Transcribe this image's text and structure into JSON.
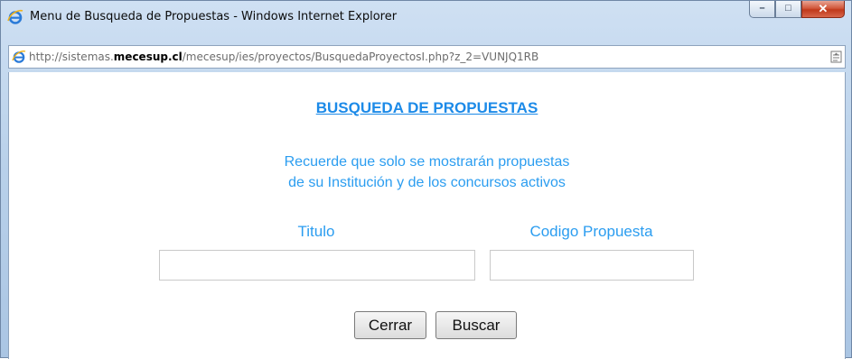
{
  "window": {
    "title": "Menu de Busqueda de Propuestas - Windows Internet Explorer",
    "controls": {
      "minimize": "–",
      "maximize": "□",
      "close": "✕"
    }
  },
  "address_bar": {
    "url_prefix": "http://sistemas.",
    "url_domain": "mecesup.cl",
    "url_path": "/mecesup/ies/proyectos/BusquedaProyectosI.php?z_2=VUNJQ1RB"
  },
  "page": {
    "heading": "BUSQUEDA DE PROPUESTAS",
    "notice_line1": "Recuerde que solo se mostrarán propuestas",
    "notice_line2": "de su Institución y de los concursos activos",
    "fields": {
      "titulo_label": "Titulo",
      "titulo_value": "",
      "codigo_label": "Codigo Propuesta",
      "codigo_value": ""
    },
    "buttons": {
      "close": "Cerrar",
      "search": "Buscar"
    }
  },
  "colors": {
    "accent": "#1c8ae8",
    "text_blue": "#2b9df0",
    "close_red": "#c0391b"
  },
  "icons": {
    "browser": "ie-logo-icon",
    "compat": "compatibility-view-icon"
  }
}
